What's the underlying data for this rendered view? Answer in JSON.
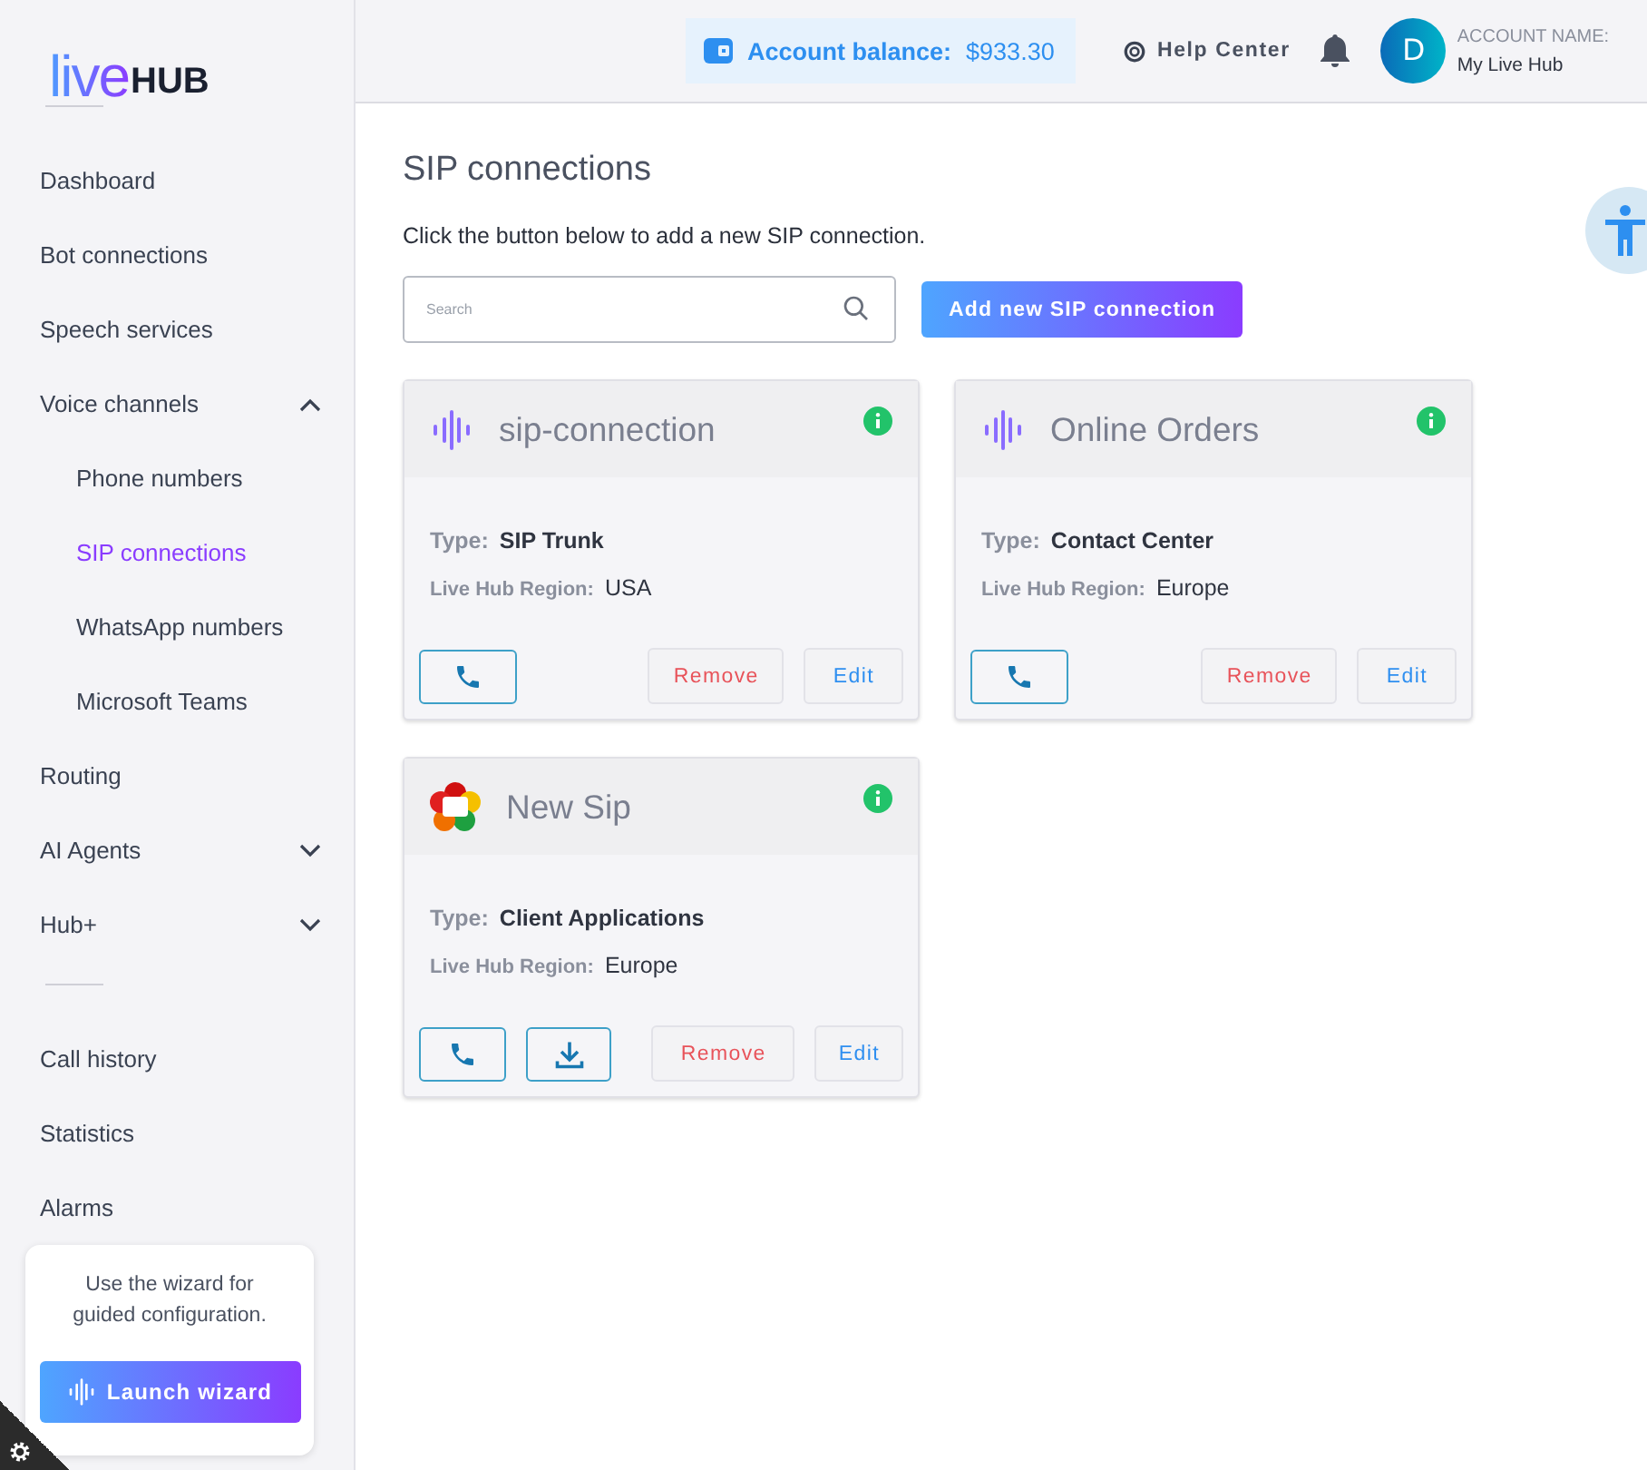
{
  "logo": {
    "part_1": "live",
    "part_2": "HUB"
  },
  "sidebar": {
    "groups": [
      {
        "items": [
          {
            "label": "Dashboard",
            "selected": false
          },
          {
            "label": "Bot connections",
            "selected": false
          },
          {
            "label": "Speech services",
            "selected": false
          },
          {
            "label": "Voice channels",
            "selected": false,
            "expanded": true,
            "children": [
              {
                "label": "Phone numbers",
                "selected": false
              },
              {
                "label": "SIP connections",
                "selected": true
              },
              {
                "label": "WhatsApp numbers",
                "selected": false
              },
              {
                "label": "Microsoft Teams",
                "selected": false
              }
            ]
          },
          {
            "label": "Routing",
            "selected": false
          },
          {
            "label": "AI Agents",
            "selected": false,
            "expanded": false
          },
          {
            "label": "Hub+",
            "selected": false,
            "expanded": false
          }
        ]
      },
      {
        "items": [
          {
            "label": "Call history",
            "selected": false
          },
          {
            "label": "Statistics",
            "selected": false
          },
          {
            "label": "Alarms",
            "selected": false
          }
        ]
      }
    ],
    "wizard": {
      "text": "Use the wizard for guided configuration.",
      "button": "Launch wizard"
    }
  },
  "header": {
    "balance_label": "Account balance:",
    "balance": "$933.30",
    "help": "Help Center",
    "avatar": "D",
    "account_label": "ACCOUNT NAME:",
    "account_name": "My Live Hub"
  },
  "page": {
    "title": "SIP connections",
    "intro": "Click the button below to add a new SIP connection.",
    "search": {
      "placeholder": "Search"
    },
    "add_button": "Add new SIP connection"
  },
  "cards": [
    {
      "kind": "sip",
      "name": "sip-connection",
      "type_label": "Type:",
      "type": "SIP Trunk",
      "region_label": "Live Hub Region:",
      "region": "USA",
      "download": false,
      "remove": "Remove",
      "edit": "Edit"
    },
    {
      "kind": "sip",
      "name": "Online Orders",
      "type_label": "Type:",
      "type": "Contact Center",
      "region_label": "Live Hub Region:",
      "region": "Europe",
      "download": false,
      "remove": "Remove",
      "edit": "Edit"
    },
    {
      "kind": "webrtc",
      "name": "New Sip",
      "type_label": "Type:",
      "type": "Client Applications",
      "region_label": "Live Hub Region:",
      "region": "Europe",
      "download": true,
      "remove": "Remove",
      "edit": "Edit"
    }
  ]
}
